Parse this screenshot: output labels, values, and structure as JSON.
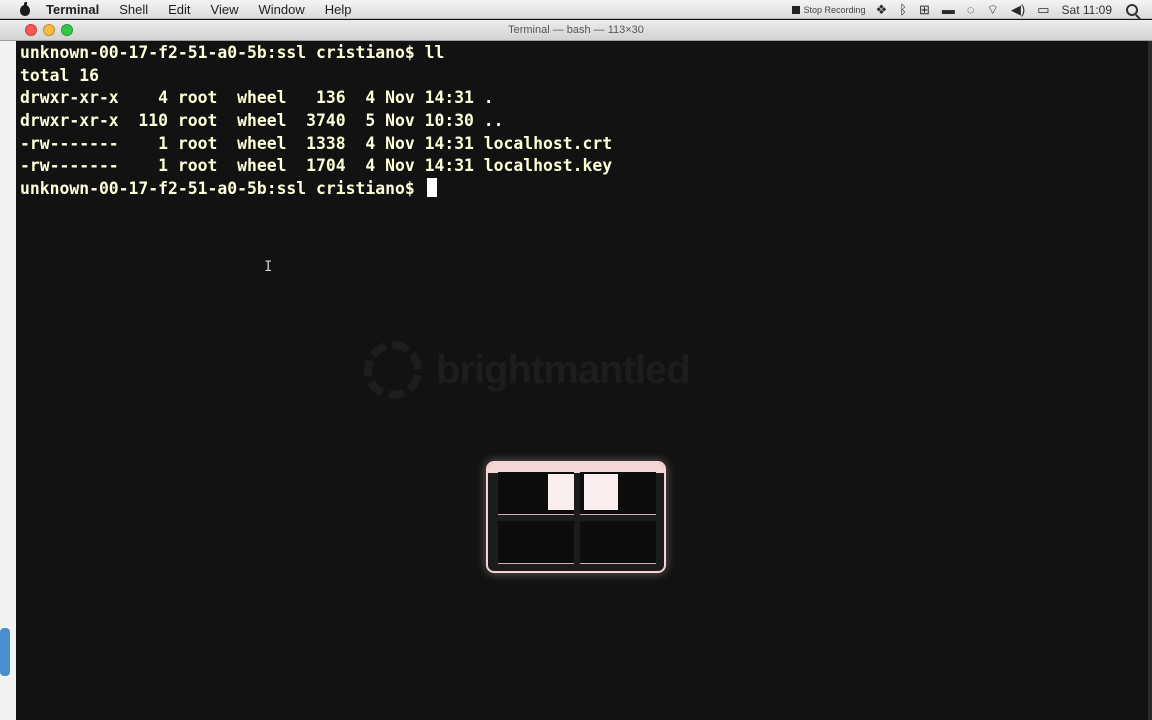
{
  "menubar": {
    "app_name": "Terminal",
    "items": [
      "Shell",
      "Edit",
      "View",
      "Window",
      "Help"
    ],
    "stop_recording": "Stop Recording",
    "clock": "Sat 11:09"
  },
  "window": {
    "title": "Terminal — bash — 113×30"
  },
  "terminal": {
    "lines": [
      "unknown-00-17-f2-51-a0-5b:ssl cristiano$ ll",
      "total 16",
      "drwxr-xr-x    4 root  wheel   136  4 Nov 14:31 .",
      "drwxr-xr-x  110 root  wheel  3740  5 Nov 10:30 ..",
      "-rw-------    1 root  wheel  1338  4 Nov 14:31 localhost.crt",
      "-rw-------    1 root  wheel  1704  4 Nov 14:31 localhost.key"
    ],
    "prompt": "unknown-00-17-f2-51-a0-5b:ssl cristiano$ "
  },
  "watermark": "brightmantled",
  "colors": {
    "terminal_bg": "#121212",
    "terminal_text": "#ffffd9",
    "hud_border": "#f5d6d6"
  }
}
